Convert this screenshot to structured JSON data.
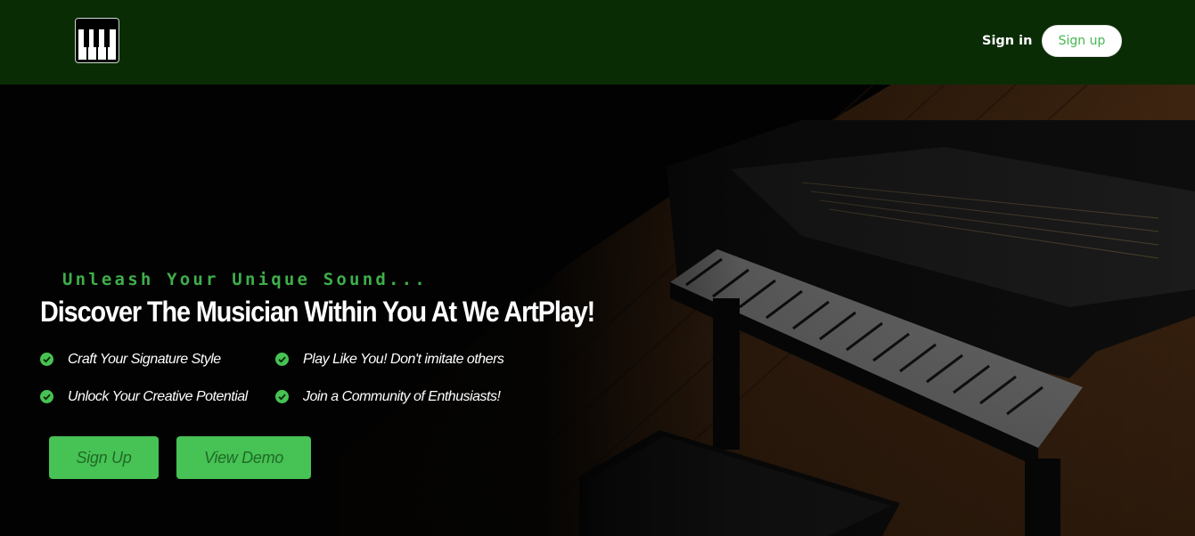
{
  "header": {
    "logo_icon": "piano-keys-icon",
    "signin_label": "Sign in",
    "signup_label": "Sign up"
  },
  "hero": {
    "tagline": "Unleash Your Unique Sound...",
    "headline": "Discover The Musician Within You At We ArtPlay!",
    "features": [
      "Craft Your Signature Style",
      "Play Like You! Don't imitate others",
      "Unlock Your Creative Potential",
      "Join a Community of Enthusiasts!"
    ],
    "feature_icon": "check-circle-icon",
    "buttons": {
      "primary": "Sign Up",
      "secondary": "View Demo"
    }
  },
  "colors": {
    "header_bg": "#0a2c05",
    "accent_green": "#47c254",
    "tagline_green": "#3fae4a",
    "hero_bg": "#020202"
  }
}
